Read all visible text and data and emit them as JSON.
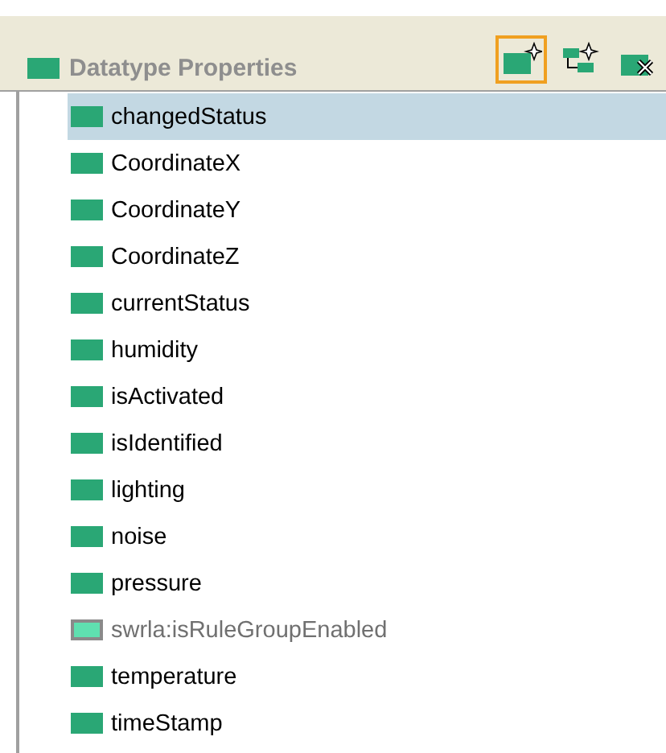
{
  "header": {
    "title": "Datatype Properties",
    "toolbar": [
      {
        "kind": "create",
        "selected": true
      },
      {
        "kind": "create-sub",
        "selected": false
      },
      {
        "kind": "delete",
        "selected": false
      }
    ]
  },
  "properties": [
    {
      "name": "changedStatus",
      "kind": "owned",
      "selected": true
    },
    {
      "name": "CoordinateX",
      "kind": "owned",
      "selected": false
    },
    {
      "name": "CoordinateY",
      "kind": "owned",
      "selected": false
    },
    {
      "name": "CoordinateZ",
      "kind": "owned",
      "selected": false
    },
    {
      "name": "currentStatus",
      "kind": "owned",
      "selected": false
    },
    {
      "name": "humidity",
      "kind": "owned",
      "selected": false
    },
    {
      "name": "isActivated",
      "kind": "owned",
      "selected": false
    },
    {
      "name": "isIdentified",
      "kind": "owned",
      "selected": false
    },
    {
      "name": "lighting",
      "kind": "owned",
      "selected": false
    },
    {
      "name": "noise",
      "kind": "owned",
      "selected": false
    },
    {
      "name": "pressure",
      "kind": "owned",
      "selected": false
    },
    {
      "name": "swrla:isRuleGroupEnabled",
      "kind": "imported",
      "selected": false
    },
    {
      "name": "temperature",
      "kind": "owned",
      "selected": false
    },
    {
      "name": "timeStamp",
      "kind": "owned",
      "selected": false
    }
  ]
}
